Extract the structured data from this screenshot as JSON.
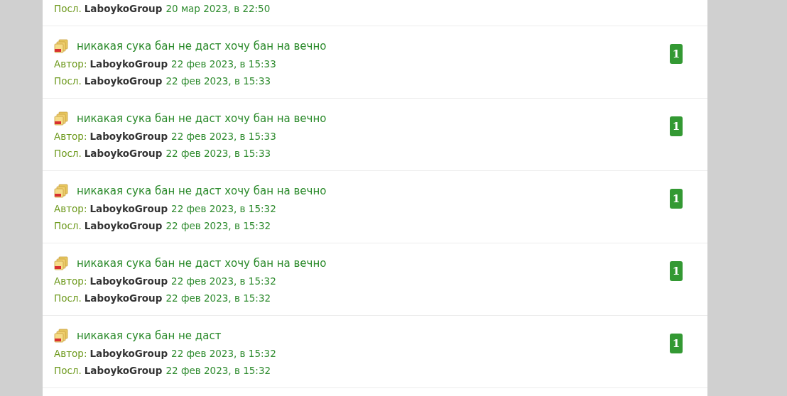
{
  "topics": [
    {
      "last": {
        "label": "Посл.",
        "author": "LaboykoGroup",
        "date": "20 мар 2023, в 22:50"
      }
    },
    {
      "title": "никакая сука бан не даст хочу бан на вечно",
      "author": {
        "label": "Автор:",
        "author": "LaboykoGroup",
        "date": "22 фев 2023, в 15:33"
      },
      "last": {
        "label": "Посл.",
        "author": "LaboykoGroup",
        "date": "22 фев 2023, в 15:33"
      },
      "count": "1"
    },
    {
      "title": "никакая сука бан не даст хочу бан на вечно",
      "author": {
        "label": "Автор:",
        "author": "LaboykoGroup",
        "date": "22 фев 2023, в 15:33"
      },
      "last": {
        "label": "Посл.",
        "author": "LaboykoGroup",
        "date": "22 фев 2023, в 15:33"
      },
      "count": "1"
    },
    {
      "title": "никакая сука бан не даст хочу бан на вечно",
      "author": {
        "label": "Автор:",
        "author": "LaboykoGroup",
        "date": "22 фев 2023, в 15:32"
      },
      "last": {
        "label": "Посл.",
        "author": "LaboykoGroup",
        "date": "22 фев 2023, в 15:32"
      },
      "count": "1"
    },
    {
      "title": "никакая сука бан не даст хочу бан на вечно",
      "author": {
        "label": "Автор:",
        "author": "LaboykoGroup",
        "date": "22 фев 2023, в 15:32"
      },
      "last": {
        "label": "Посл.",
        "author": "LaboykoGroup",
        "date": "22 фев 2023, в 15:32"
      },
      "count": "1"
    },
    {
      "title": "никакая сука бан не даст",
      "author": {
        "label": "Автор:",
        "author": "LaboykoGroup",
        "date": "22 фев 2023, в 15:32"
      },
      "last": {
        "label": "Посл.",
        "author": "LaboykoGroup",
        "date": "22 фев 2023, в 15:32"
      },
      "count": "1"
    }
  ]
}
